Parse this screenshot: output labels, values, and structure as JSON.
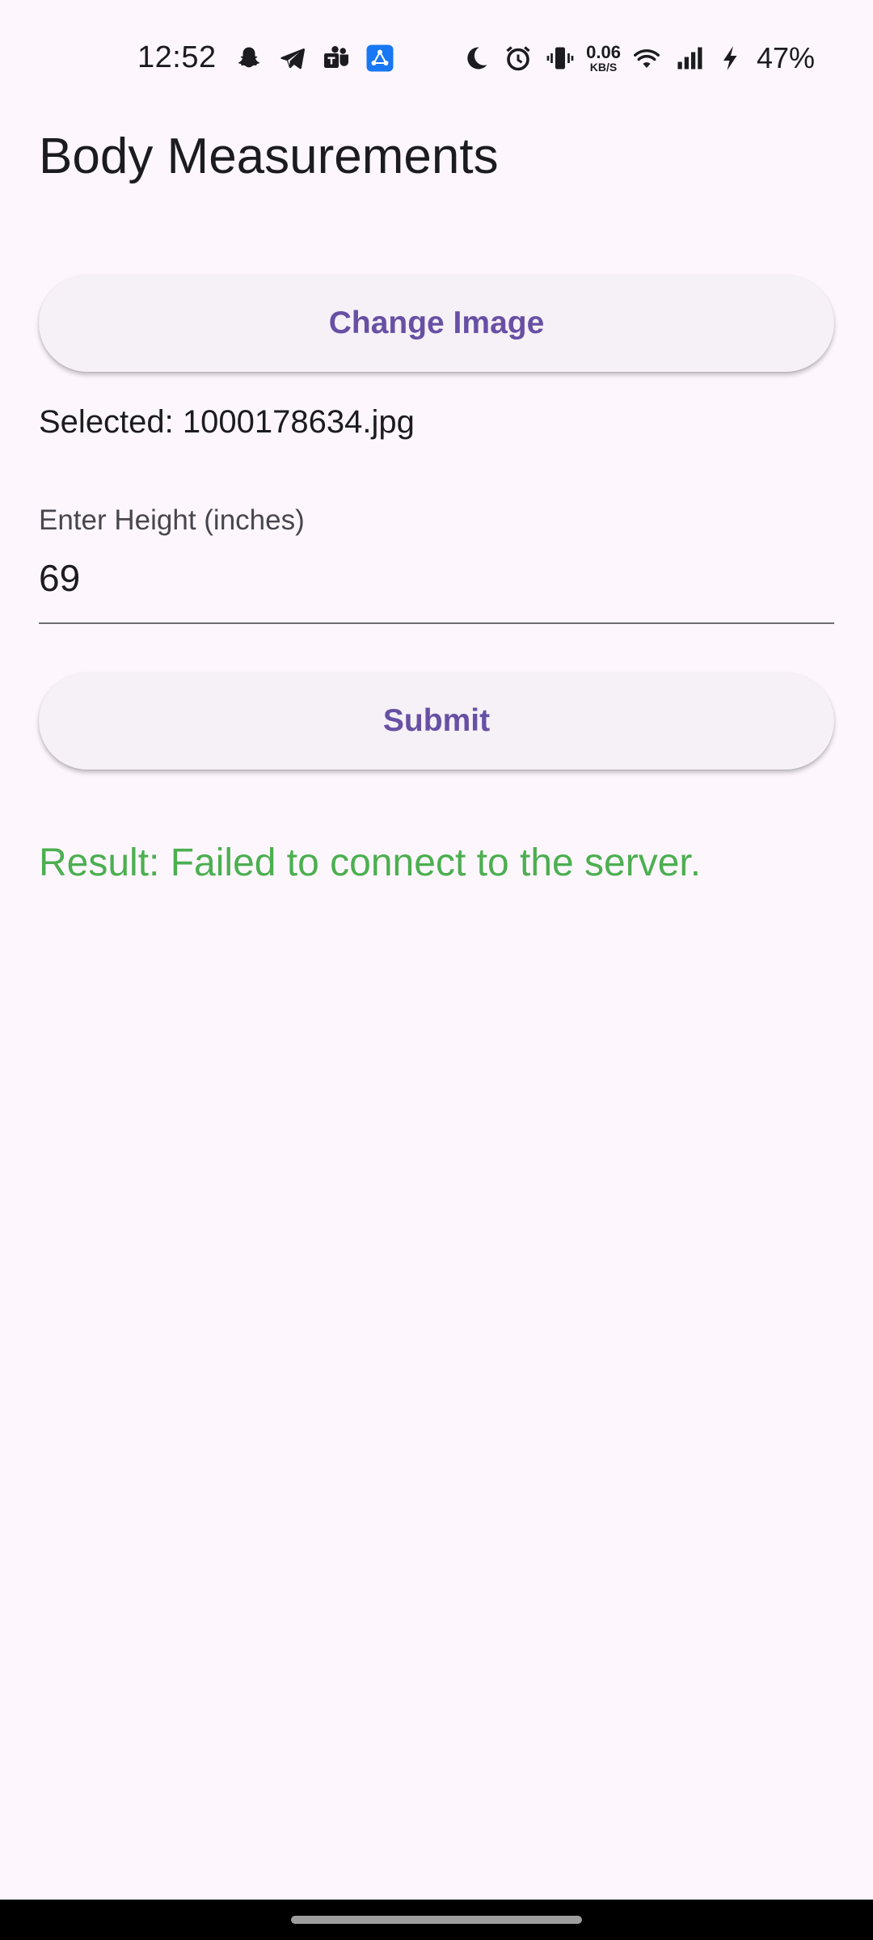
{
  "status_bar": {
    "time": "12:52",
    "left_icons": [
      "snapchat-icon",
      "telegram-icon",
      "teams-icon",
      "app-icon"
    ],
    "net_speed_value": "0.06",
    "net_speed_unit": "KB/S",
    "right_icons": [
      "moon-icon",
      "alarm-icon",
      "vibrate-icon",
      "wifi-icon",
      "signal-icon",
      "charging-icon"
    ],
    "battery": "47%"
  },
  "header": {
    "title": "Body Measurements"
  },
  "main": {
    "change_image_label": "Change Image",
    "selected_file": "Selected: 1000178634.jpg",
    "height_label": "Enter Height (inches)",
    "height_value": "69",
    "submit_label": "Submit",
    "result": "Result: Failed to connect to the server."
  },
  "colors": {
    "background": "#fdf7fd",
    "button_bg": "#f6f1f7",
    "accent": "#6750a4",
    "result": "#4caf50"
  }
}
